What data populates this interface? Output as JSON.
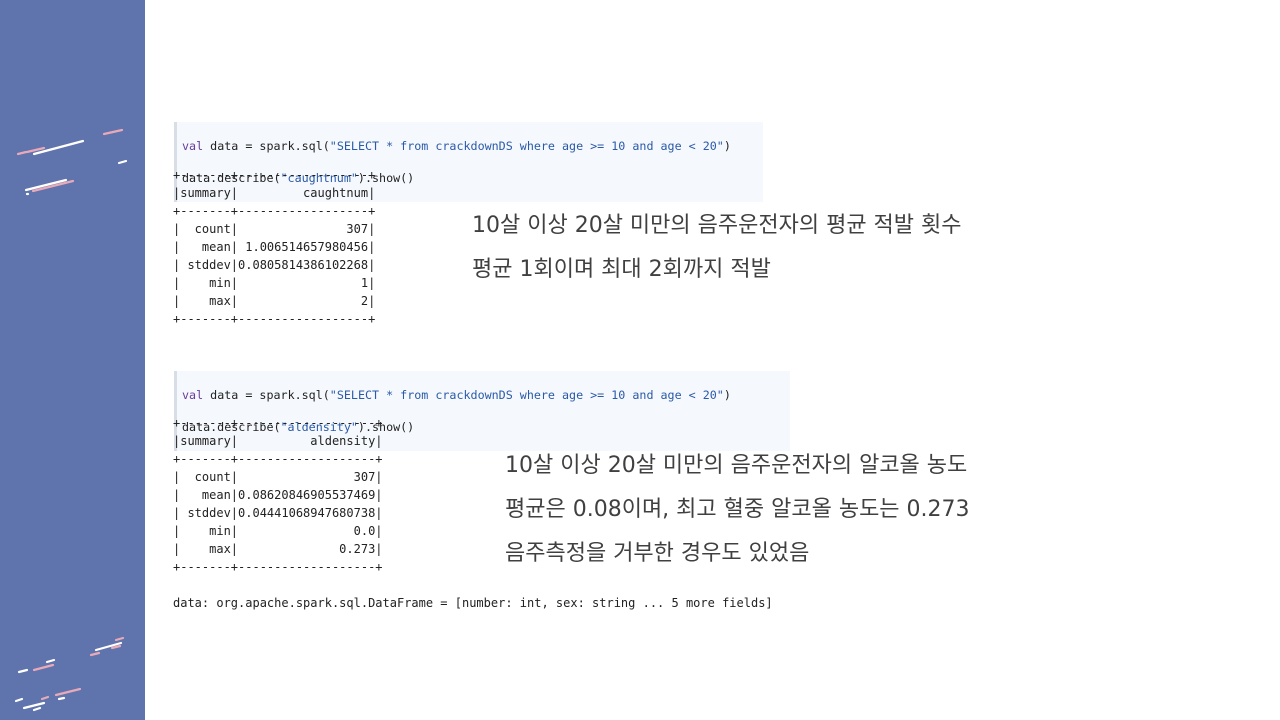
{
  "block1": {
    "code_line1_kw": "val",
    "code_line1_rest": " data = spark.sql(",
    "code_line1_str": "\"SELECT * from crackdownDS where age >= 10 and age < 20\"",
    "code_line1_end": ")",
    "code_line2_start": "data.describe(",
    "code_line2_str": "\"caughtnum\"",
    "code_line2_end": ").show()",
    "output": "+-------+------------------+\n|summary|         caughtnum|\n+-------+------------------+\n|  count|               307|\n|   mean| 1.006514657980456|\n| stddev|0.0805814386102268|\n|    min|                 1|\n|    max|                 2|\n+-------+------------------+",
    "note": [
      "10살 이상 20살 미만의 음주운전자의 평균 적발 횟수",
      "평균 1회이며 최대 2회까지 적발"
    ]
  },
  "block2": {
    "code_line1_kw": "val",
    "code_line1_rest": " data = spark.sql(",
    "code_line1_str": "\"SELECT * from crackdownDS where age >= 10 and age < 20\"",
    "code_line1_end": ")",
    "code_line2_start": "data.describe(",
    "code_line2_str": "\"aldensity\"",
    "code_line2_end": ").show()",
    "output": "+-------+-------------------+\n|summary|          aldensity|\n+-------+-------------------+\n|  count|                307|\n|   mean|0.08620846905537469|\n| stddev|0.04441068947680738|\n|    min|                0.0|\n|    max|              0.273|\n+-------+-------------------+\n\ndata: org.apache.spark.sql.DataFrame = [number: int, sex: string ... 5 more fields]",
    "note": [
      "10살 이상 20살 미만의 음주운전자의 알코올 농도",
      "평균은 0.08이며, 최고 혈중 알코올 농도는 0.273",
      "음주측정을 거부한 경우도 있었음"
    ]
  },
  "colors": {
    "sidebar": "#5f73ad",
    "stroke_white": "#ffffff",
    "stroke_pink": "#e8a9b8"
  }
}
